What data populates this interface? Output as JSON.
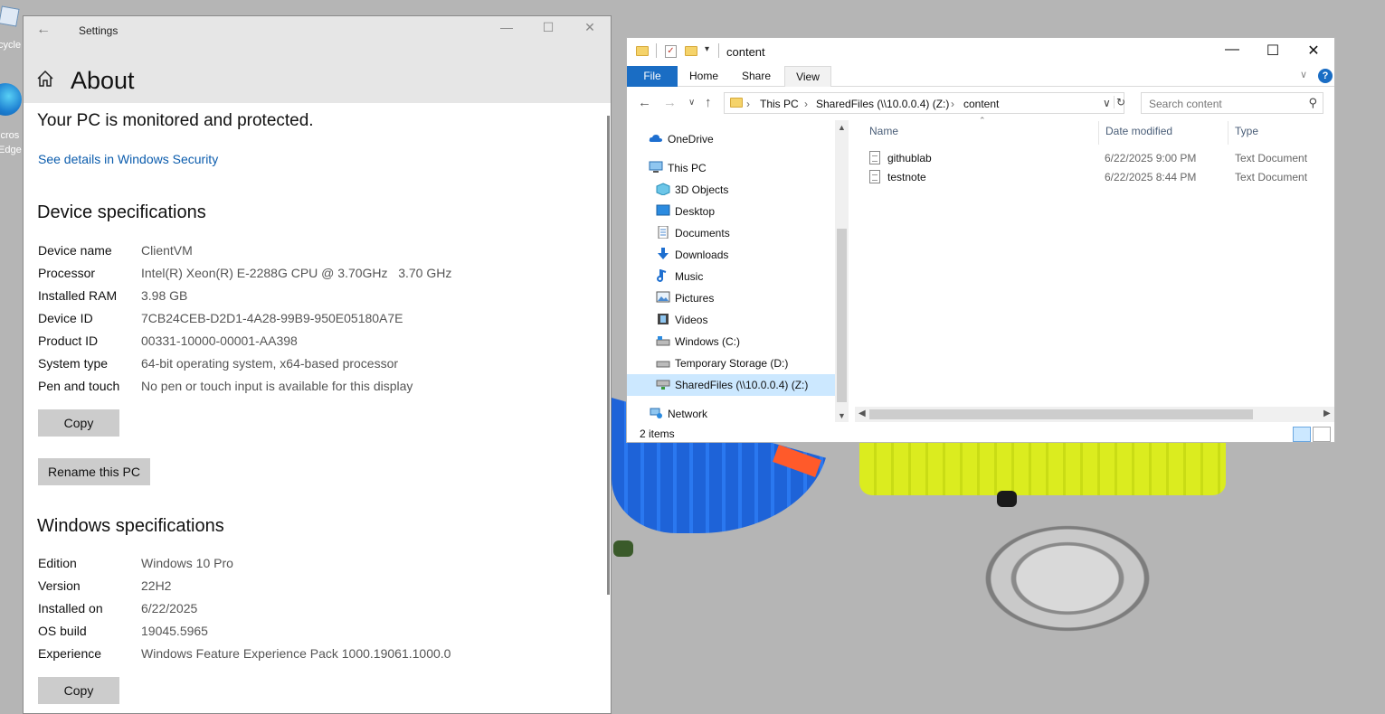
{
  "desktop": {
    "icons": [
      {
        "label": "cycle"
      },
      {
        "label": "icros\nEdge"
      }
    ]
  },
  "settings": {
    "window_title": "Settings",
    "page_title": "About",
    "protection_status": "Your PC is monitored and protected.",
    "security_link": "See details in Windows Security",
    "device_spec_heading": "Device specifications",
    "device_specs": [
      {
        "key": "Device name",
        "value": "ClientVM"
      },
      {
        "key": "Processor",
        "value": "Intel(R) Xeon(R) E-2288G CPU @ 3.70GHz   3.70 GHz"
      },
      {
        "key": "Installed RAM",
        "value": "3.98 GB"
      },
      {
        "key": "Device ID",
        "value": "7CB24CEB-D2D1-4A28-99B9-950E05180A7E"
      },
      {
        "key": "Product ID",
        "value": "00331-10000-00001-AA398"
      },
      {
        "key": "System type",
        "value": "64-bit operating system, x64-based processor"
      },
      {
        "key": "Pen and touch",
        "value": "No pen or touch input is available for this display"
      }
    ],
    "copy_label": "Copy",
    "rename_label": "Rename this PC",
    "windows_spec_heading": "Windows specifications",
    "windows_specs": [
      {
        "key": "Edition",
        "value": "Windows 10 Pro"
      },
      {
        "key": "Version",
        "value": "22H2"
      },
      {
        "key": "Installed on",
        "value": "6/22/2025"
      },
      {
        "key": "OS build",
        "value": "19045.5965"
      },
      {
        "key": "Experience",
        "value": "Windows Feature Experience Pack 1000.19061.1000.0"
      }
    ],
    "copy2_label": "Copy"
  },
  "explorer": {
    "window_title": "content",
    "ribbon_tabs": [
      "File",
      "Home",
      "Share",
      "View"
    ],
    "address": [
      "This PC",
      "SharedFiles (\\\\10.0.0.4) (Z:)",
      "content"
    ],
    "search_placeholder": "Search content",
    "nav_items": [
      {
        "label": "OneDrive",
        "icon": "cloud-icon"
      },
      {
        "label": "This PC",
        "icon": "pc-icon"
      },
      {
        "label": "3D Objects",
        "icon": "cube-icon"
      },
      {
        "label": "Desktop",
        "icon": "desktop-icon"
      },
      {
        "label": "Documents",
        "icon": "documents-icon"
      },
      {
        "label": "Downloads",
        "icon": "download-icon"
      },
      {
        "label": "Music",
        "icon": "music-icon"
      },
      {
        "label": "Pictures",
        "icon": "pictures-icon"
      },
      {
        "label": "Videos",
        "icon": "videos-icon"
      },
      {
        "label": "Windows (C:)",
        "icon": "drive-icon"
      },
      {
        "label": "Temporary Storage (D:)",
        "icon": "drive-icon"
      },
      {
        "label": "SharedFiles (\\\\10.0.0.4) (Z:)",
        "icon": "network-drive-icon",
        "selected": true
      },
      {
        "label": "Network",
        "icon": "network-icon"
      }
    ],
    "columns": [
      "Name",
      "Date modified",
      "Type"
    ],
    "files": [
      {
        "name": "githublab",
        "date": "6/22/2025 9:00 PM",
        "type": "Text Document"
      },
      {
        "name": "testnote",
        "date": "6/22/2025 8:44 PM",
        "type": "Text Document"
      }
    ],
    "status_count": "2 items",
    "accent_color": "#1a6dc4"
  }
}
